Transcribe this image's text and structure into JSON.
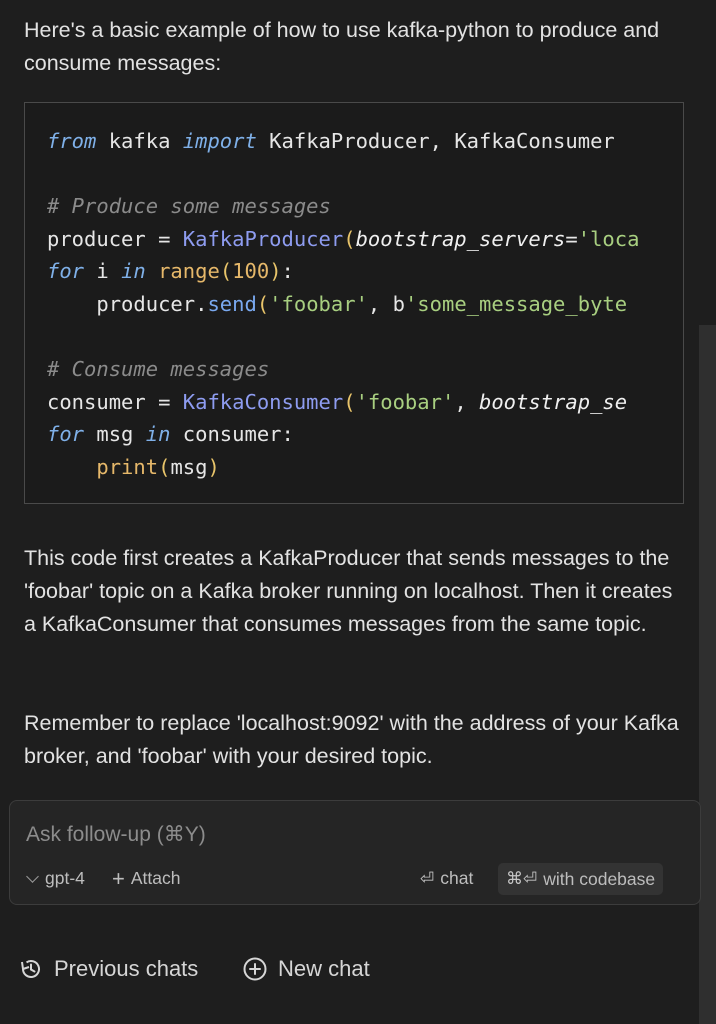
{
  "message": {
    "intro": "Here's a basic example of how to use kafka-python to produce and consume messages:",
    "code_lines": [
      [
        {
          "t": "from",
          "c": "kw"
        },
        {
          "t": " kafka ",
          "c": ""
        },
        {
          "t": "import",
          "c": "kw"
        },
        {
          "t": " KafkaProducer, KafkaConsumer",
          "c": ""
        }
      ],
      [],
      [
        {
          "t": "# Produce some messages",
          "c": "cm"
        }
      ],
      [
        {
          "t": "producer = ",
          "c": ""
        },
        {
          "t": "KafkaProducer",
          "c": "cls"
        },
        {
          "t": "(",
          "c": "pn"
        },
        {
          "t": "bootstrap_servers",
          "c": "pr"
        },
        {
          "t": "=",
          "c": ""
        },
        {
          "t": "'loca",
          "c": "str"
        }
      ],
      [
        {
          "t": "for",
          "c": "kw"
        },
        {
          "t": " i ",
          "c": ""
        },
        {
          "t": "in",
          "c": "kw"
        },
        {
          "t": " ",
          "c": ""
        },
        {
          "t": "range",
          "c": "bi"
        },
        {
          "t": "(",
          "c": "pn"
        },
        {
          "t": "100",
          "c": "num"
        },
        {
          "t": ")",
          "c": "pn"
        },
        {
          "t": ":",
          "c": ""
        }
      ],
      [
        {
          "t": "    producer.",
          "c": ""
        },
        {
          "t": "send",
          "c": "fn"
        },
        {
          "t": "(",
          "c": "pn"
        },
        {
          "t": "'foobar'",
          "c": "str"
        },
        {
          "t": ", b",
          "c": ""
        },
        {
          "t": "'some_message_byte",
          "c": "str"
        }
      ],
      [],
      [
        {
          "t": "# Consume messages",
          "c": "cm"
        }
      ],
      [
        {
          "t": "consumer = ",
          "c": ""
        },
        {
          "t": "KafkaConsumer",
          "c": "cls"
        },
        {
          "t": "(",
          "c": "pn"
        },
        {
          "t": "'foobar'",
          "c": "str"
        },
        {
          "t": ", ",
          "c": ""
        },
        {
          "t": "bootstrap_se",
          "c": "pr"
        }
      ],
      [
        {
          "t": "for",
          "c": "kw"
        },
        {
          "t": " msg ",
          "c": ""
        },
        {
          "t": "in",
          "c": "kw"
        },
        {
          "t": " consumer:",
          "c": ""
        }
      ],
      [
        {
          "t": "    ",
          "c": ""
        },
        {
          "t": "print",
          "c": "bi"
        },
        {
          "t": "(",
          "c": "pn"
        },
        {
          "t": "msg",
          "c": ""
        },
        {
          "t": ")",
          "c": "pn"
        }
      ]
    ],
    "explanation": "This code first creates a KafkaProducer that sends messages to the 'foobar' topic on a Kafka broker running on localhost. Then it creates a KafkaConsumer that consumes messages from the same topic.",
    "reminder": "Remember to replace 'localhost:9092' with the address of your Kafka broker, and 'foobar' with your desired topic."
  },
  "followup": {
    "placeholder": "Ask follow-up (⌘Y)",
    "value": "",
    "model": "gpt-4",
    "attach_label": "Attach",
    "chat_label": "chat",
    "codebase_label": "with codebase"
  },
  "footer": {
    "previous_chats": "Previous chats",
    "new_chat": "New chat"
  },
  "icons": {
    "history": "history-icon",
    "new_chat": "plus-circle-icon",
    "enter": "enter-icon",
    "command": "command-icon"
  }
}
